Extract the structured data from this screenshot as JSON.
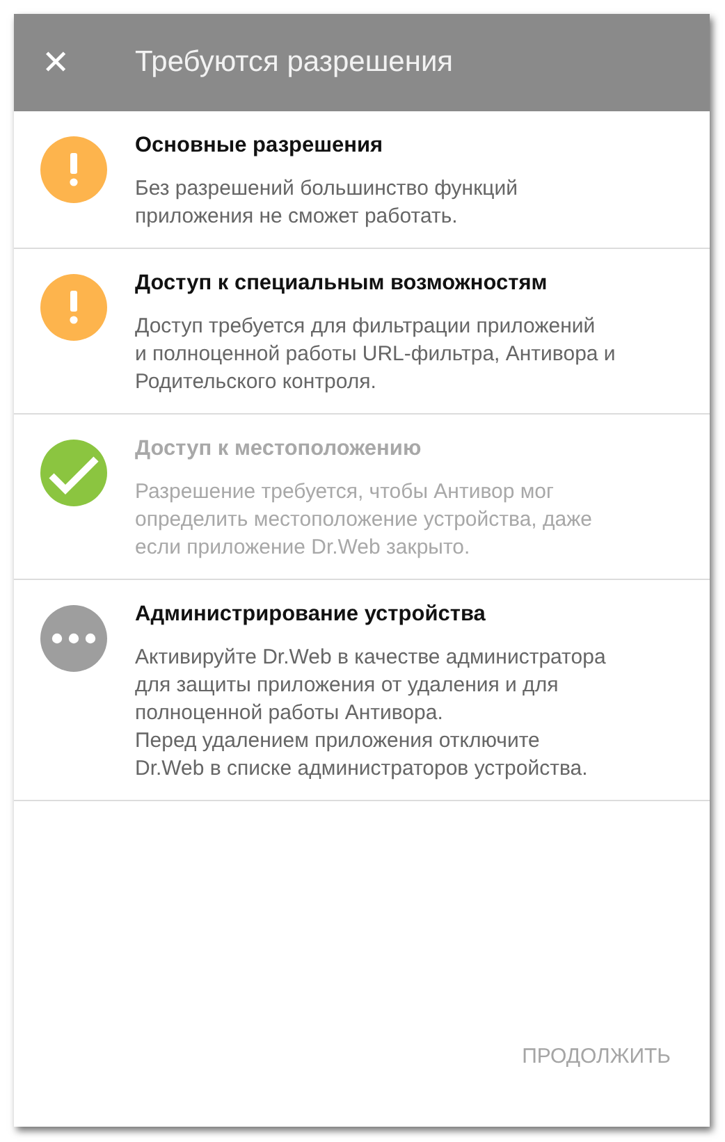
{
  "dialog": {
    "title": "Требуются разрешения",
    "close_icon": "✕"
  },
  "permissions": [
    {
      "kind": "warning",
      "disabled": false,
      "title": "Основные разрешения",
      "description": "Без разрешений большинство функций\nприложения не сможет работать."
    },
    {
      "kind": "warning",
      "disabled": false,
      "title": "Доступ к специальным возможностям",
      "description": "Доступ требуется для фильтрации приложений\nи полноценной работы URL-фильтра, Антивора и\nРодительского контроля."
    },
    {
      "kind": "granted",
      "disabled": true,
      "title": "Доступ к местоположению",
      "description": "Разрешение требуется, чтобы Антивор мог\nопределить местоположение устройства, даже\nесли приложение Dr.Web закрыто."
    },
    {
      "kind": "pending",
      "disabled": false,
      "title": "Администрирование устройства",
      "description": "Активируйте Dr.Web в качестве администратора\nдля защиты приложения от удаления и для\nполноценной работы Антивора.\nПеред удалением приложения отключите\nDr.Web в списке администраторов устройства."
    }
  ],
  "continue_button": {
    "label": "ПРОДОЛЖИТЬ",
    "disabled": true
  }
}
